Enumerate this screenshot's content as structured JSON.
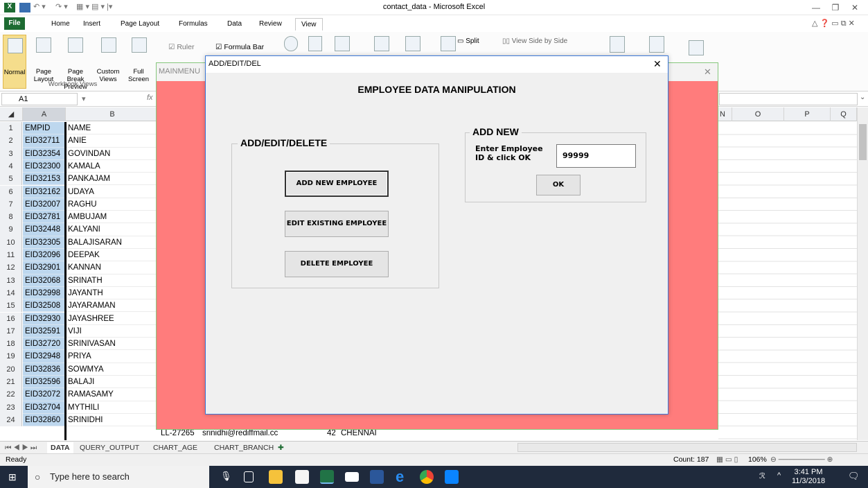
{
  "window": {
    "title": "contact_data - Microsoft Excel"
  },
  "ribbon": {
    "tabs": [
      "File",
      "Home",
      "Insert",
      "Page Layout",
      "Formulas",
      "Data",
      "Review",
      "View"
    ],
    "buttons": {
      "normal": "Normal",
      "page_layout": "Page Layout",
      "page_break": "Page Break Preview",
      "custom_views": "Custom Views",
      "full_screen": "Full Screen",
      "ruler": "Ruler",
      "formula_bar": "Formula Bar",
      "split": "Split",
      "side_by_side": "View Side by Side"
    },
    "group_workbook_views": "Workbook Views"
  },
  "formula_bar": {
    "name_box": "A1",
    "fx": "fx"
  },
  "columns": [
    "A",
    "B",
    "N",
    "O",
    "P",
    "Q"
  ],
  "rows": [
    {
      "n": "1",
      "a": "EMPID",
      "b": "NAME"
    },
    {
      "n": "2",
      "a": "EID32711",
      "b": "ANIE"
    },
    {
      "n": "3",
      "a": "EID32354",
      "b": "GOVINDAN"
    },
    {
      "n": "4",
      "a": "EID32300",
      "b": "KAMALA"
    },
    {
      "n": "5",
      "a": "EID32153",
      "b": "PANKAJAM"
    },
    {
      "n": "6",
      "a": "EID32162",
      "b": "UDAYA"
    },
    {
      "n": "7",
      "a": "EID32007",
      "b": "RAGHU"
    },
    {
      "n": "8",
      "a": "EID32781",
      "b": "AMBUJAM"
    },
    {
      "n": "9",
      "a": "EID32448",
      "b": "KALYANI"
    },
    {
      "n": "10",
      "a": "EID32305",
      "b": "BALAJISARAN"
    },
    {
      "n": "11",
      "a": "EID32096",
      "b": "DEEPAK"
    },
    {
      "n": "12",
      "a": "EID32901",
      "b": "KANNAN"
    },
    {
      "n": "13",
      "a": "EID32068",
      "b": "SRINATH"
    },
    {
      "n": "14",
      "a": "EID32998",
      "b": "JAYANTH"
    },
    {
      "n": "15",
      "a": "EID32508",
      "b": "JAYARAMAN"
    },
    {
      "n": "16",
      "a": "EID32930",
      "b": "JAYASHREE"
    },
    {
      "n": "17",
      "a": "EID32591",
      "b": "VIJI"
    },
    {
      "n": "18",
      "a": "EID32720",
      "b": "SRINIVASAN"
    },
    {
      "n": "19",
      "a": "EID32948",
      "b": "PRIYA"
    },
    {
      "n": "20",
      "a": "EID32836",
      "b": "SOWMYA"
    },
    {
      "n": "21",
      "a": "EID32596",
      "b": "BALAJI"
    },
    {
      "n": "22",
      "a": "EID32072",
      "b": "RAMASAMY"
    },
    {
      "n": "23",
      "a": "EID32704",
      "b": "MYTHILI"
    },
    {
      "n": "24",
      "a": "EID32860",
      "b": "SRINIDHI"
    }
  ],
  "row24_extra": {
    "c": "LL-27265",
    "d": "srinidhi@rediffmail.cc",
    "age": "42",
    "city": "CHENNAI"
  },
  "sheets": [
    "DATA",
    "QUERY_OUTPUT",
    "CHART_AGE",
    "CHART_BRANCH"
  ],
  "status": {
    "ready": "Ready",
    "count": "Count: 187",
    "zoom": "106%"
  },
  "mainmenu": {
    "title": "MAINMENU"
  },
  "dialog": {
    "title": "ADD/EDIT/DEL",
    "heading": "EMPLOYEE DATA MANIPULATION",
    "group_left": "ADD/EDIT/DELETE",
    "btn_add": "ADD NEW EMPLOYEE",
    "btn_edit": "EDIT EXISTING EMPLOYEE",
    "btn_delete": "DELETE EMPLOYEE",
    "group_right": "ADD NEW",
    "prompt_line1": "Enter Employee",
    "prompt_line2": "ID & click OK",
    "employee_id": "99999",
    "btn_ok": "OK"
  },
  "taskbar": {
    "search_placeholder": "Type here to search",
    "time": "3:41 PM",
    "date": "11/3/2018"
  }
}
